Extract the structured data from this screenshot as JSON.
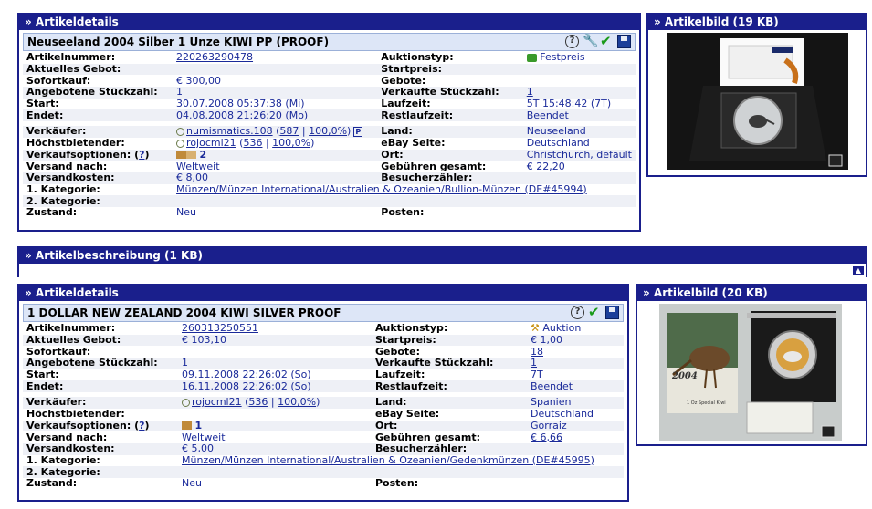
{
  "listing1": {
    "header": "» Artikeldetails",
    "title": "Neuseeland 2004 Silber 1 Unze KIWI PP (PROOF)",
    "artikelnummer_label": "Artikelnummer:",
    "artikelnummer": "220263290478",
    "auktionstyp_label": "Auktionstyp:",
    "auktionstyp": "Festpreis",
    "gebot_label": "Aktuelles Gebot:",
    "gebot": "",
    "startpreis_label": "Startpreis:",
    "startpreis": "",
    "sofort_label": "Sofortkauf:",
    "sofort": "€ 300,00",
    "gebote_label": "Gebote:",
    "gebote": "",
    "stueck_label": "Angebotene Stückzahl:",
    "stueck": "1",
    "verkauft_label": "Verkaufte Stückzahl:",
    "verkauft": "1",
    "start_label": "Start:",
    "start": "30.07.2008 05:37:38 (Mi)",
    "laufzeit_label": "Laufzeit:",
    "laufzeit": "5T 15:48:42 (7T)",
    "endet_label": "Endet:",
    "endet": "04.08.2008 21:26:20 (Mo)",
    "rest_label": "Restlaufzeit:",
    "rest": "Beendet",
    "verkaeufer_label": "Verkäufer:",
    "verkaeufer": "numismatics.108",
    "verkaeufer_score": "587",
    "verkaeufer_pct": "100,0%",
    "verkaeufer_badge": "P",
    "land_label": "Land:",
    "land": "Neuseeland",
    "hoechst_label": "Höchstbietender:",
    "hoechst": "rojocml21",
    "hoechst_score": "536",
    "hoechst_pct": "100,0%",
    "seite_label": "eBay Seite:",
    "seite": "Deutschland",
    "optionen_label": "Verkaufsoptionen:",
    "optionen_help": "?",
    "optionen_count": "2",
    "ort_label": "Ort:",
    "ort": "Christchurch, default",
    "versand_label": "Versand nach:",
    "versand": "Weltweit",
    "gebuehren_label": "Gebühren gesamt:",
    "gebuehren": "€ 22,20",
    "versandkosten_label": "Versandkosten:",
    "versandkosten": "€ 8,00",
    "besucher_label": "Besucherzähler:",
    "besucher": "",
    "kat1_label": "1. Kategorie:",
    "kat1": "Münzen/Münzen International/Australien & Ozeanien/Bullion-Münzen (DE#45994)",
    "kat2_label": "2. Kategorie:",
    "kat2": "",
    "zustand_label": "Zustand:",
    "zustand": "Neu",
    "posten_label": "Posten:",
    "posten": ""
  },
  "image1": {
    "header": "» Artikelbild (19 KB)"
  },
  "description": {
    "header": "» Artikelbeschreibung (1 KB)"
  },
  "listing2": {
    "header": "» Artikeldetails",
    "title": "1 DOLLAR NEW ZEALAND 2004 KIWI SILVER PROOF",
    "artikelnummer_label": "Artikelnummer:",
    "artikelnummer": "260313250551",
    "auktionstyp_label": "Auktionstyp:",
    "auktionstyp": "Auktion",
    "gebot_label": "Aktuelles Gebot:",
    "gebot": "€ 103,10",
    "startpreis_label": "Startpreis:",
    "startpreis": "€ 1,00",
    "sofort_label": "Sofortkauf:",
    "sofort": "",
    "gebote_label": "Gebote:",
    "gebote": "18",
    "stueck_label": "Angebotene Stückzahl:",
    "stueck": "1",
    "verkauft_label": "Verkaufte Stückzahl:",
    "verkauft": "1",
    "start_label": "Start:",
    "start": "09.11.2008 22:26:02 (So)",
    "laufzeit_label": "Laufzeit:",
    "laufzeit": "7T",
    "endet_label": "Endet:",
    "endet": "16.11.2008 22:26:02 (So)",
    "rest_label": "Restlaufzeit:",
    "rest": "Beendet",
    "verkaeufer_label": "Verkäufer:",
    "verkaeufer": "rojocml21",
    "verkaeufer_score": "536",
    "verkaeufer_pct": "100,0%",
    "land_label": "Land:",
    "land": "Spanien",
    "hoechst_label": "Höchstbietender:",
    "hoechst": "",
    "seite_label": "eBay Seite:",
    "seite": "Deutschland",
    "optionen_label": "Verkaufsoptionen:",
    "optionen_help": "?",
    "optionen_count": "1",
    "ort_label": "Ort:",
    "ort": "Gorraiz",
    "versand_label": "Versand nach:",
    "versand": "Weltweit",
    "gebuehren_label": "Gebühren gesamt:",
    "gebuehren": "€ 6,66",
    "versandkosten_label": "Versandkosten:",
    "versandkosten": "€ 5,00",
    "besucher_label": "Besucherzähler:",
    "besucher": "",
    "kat1_label": "1. Kategorie:",
    "kat1": "Münzen/Münzen International/Australien & Ozeanien/Gedenkmünzen (DE#45995)",
    "kat2_label": "2. Kategorie:",
    "kat2": "",
    "zustand_label": "Zustand:",
    "zustand": "Neu",
    "posten_label": "Posten:",
    "posten": ""
  },
  "image2": {
    "header": "» Artikelbild (20 KB)",
    "box_year": "2004",
    "box_caption": "1 Oz Special Kiwi"
  },
  "colors": {
    "accent": "#1a1f8c",
    "link": "#1a2a9a",
    "row_alt": "#eef0f6"
  },
  "icons": [
    "help-icon",
    "wrench-icon",
    "check-icon",
    "save-icon",
    "festpreis-icon",
    "auction-hammer-icon",
    "search-icon",
    "scroll-up-icon"
  ]
}
